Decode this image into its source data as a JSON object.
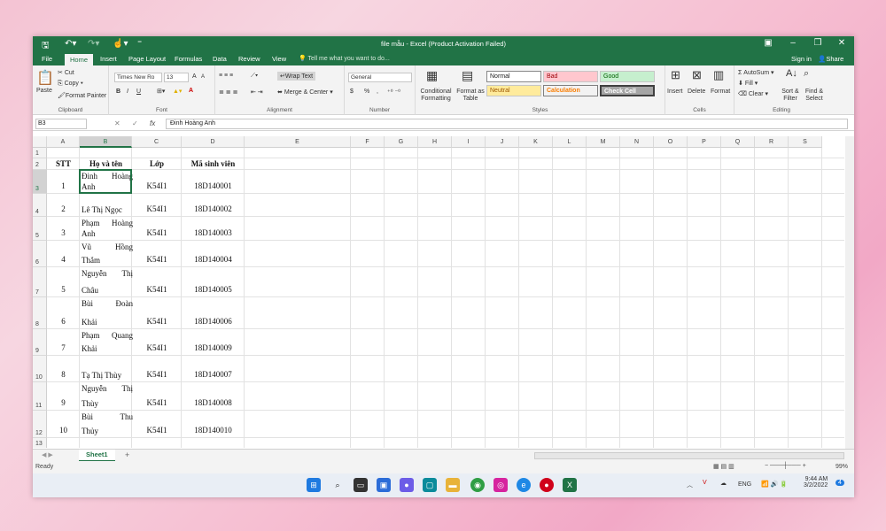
{
  "window": {
    "title": "file mẫu - Excel (Product Activation Failed)"
  },
  "tabs": [
    {
      "label": "File"
    },
    {
      "label": "Home"
    },
    {
      "label": "Insert"
    },
    {
      "label": "Page Layout"
    },
    {
      "label": "Formulas"
    },
    {
      "label": "Data"
    },
    {
      "label": "Review"
    },
    {
      "label": "View"
    }
  ],
  "tell_me": "Tell me what you want to do...",
  "account": {
    "signin": "Sign in",
    "share": "Share"
  },
  "ribbon": {
    "clipboard": {
      "label": "Clipboard",
      "paste": "Paste",
      "cut": "Cut",
      "copy": "Copy",
      "format_painter": "Format Painter"
    },
    "font": {
      "label": "Font",
      "name": "Times New Ro",
      "size": "13",
      "bold": "B",
      "italic": "I",
      "underline": "U",
      "grow": "A",
      "shrink": "A",
      "color_a": "A"
    },
    "alignment": {
      "label": "Alignment",
      "wrap": "Wrap Text",
      "merge": "Merge & Center"
    },
    "number": {
      "label": "Number",
      "format": "General",
      "currency": "$",
      "percent": "%",
      "comma": ","
    },
    "styles": {
      "label": "Styles",
      "conditional": "Conditional Formatting",
      "format_table": "Format as Table",
      "normal": "Normal",
      "bad": "Bad",
      "good": "Good",
      "neutral": "Neutral",
      "calculation": "Calculation",
      "check_cell": "Check Cell"
    },
    "cells": {
      "label": "Cells",
      "insert": "Insert",
      "delete": "Delete",
      "format": "Format"
    },
    "editing": {
      "label": "Editing",
      "autosum": "AutoSum",
      "fill": "Fill",
      "clear": "Clear",
      "sort": "Sort & Filter",
      "find": "Find & Select"
    }
  },
  "formula_bar": {
    "cell_ref": "B3",
    "fx": "fx",
    "value": "Đinh Hoàng Anh"
  },
  "columns": [
    "A",
    "B",
    "C",
    "D",
    "E",
    "F",
    "G",
    "H",
    "I",
    "J",
    "K",
    "L",
    "M",
    "N",
    "O",
    "P",
    "Q",
    "R",
    "S"
  ],
  "rows": [
    "1",
    "2",
    "3",
    "4",
    "5",
    "6",
    "7",
    "8",
    "9",
    "10",
    "11",
    "12",
    "13"
  ],
  "headers": {
    "stt": "STT",
    "name": "Họ và tên",
    "class": "Lớp",
    "id": "Mã sinh viên"
  },
  "students": [
    {
      "stt": "1",
      "name1": "Đinh Hoàng",
      "name2": "Anh",
      "class": "K54I1",
      "id": "18D140001"
    },
    {
      "stt": "2",
      "name1": "",
      "name2": "Lê Thị Ngọc",
      "class": "K54I1",
      "id": "18D140002"
    },
    {
      "stt": "3",
      "name1": "Phạm Hoàng",
      "name2": "Anh",
      "class": "K54I1",
      "id": "18D140003"
    },
    {
      "stt": "4",
      "name1": "Vũ Hồng",
      "name2": "Thắm",
      "class": "K54I1",
      "id": "18D140004"
    },
    {
      "stt": "5",
      "name1": "Nguyễn Thị",
      "name2": "Châu",
      "class": "K54I1",
      "id": "18D140005"
    },
    {
      "stt": "6",
      "name1": "Bùi Đoàn",
      "name2": "Khải",
      "class": "K54I1",
      "id": "18D140006"
    },
    {
      "stt": "7",
      "name1": "Phạm Quang",
      "name2": "Khải",
      "class": "K54I1",
      "id": "18D140009"
    },
    {
      "stt": "8",
      "name1": "",
      "name2": "Tạ Thị Thùy",
      "class": "K54I1",
      "id": "18D140007"
    },
    {
      "stt": "9",
      "name1": "Nguyễn Thị",
      "name2": "Thùy",
      "class": "K54I1",
      "id": "18D140008"
    },
    {
      "stt": "10",
      "name1": "Bùi Thu",
      "name2": "Thủy",
      "class": "K54I1",
      "id": "18D140010"
    }
  ],
  "sheet": {
    "name": "Sheet1",
    "add": "+"
  },
  "status": {
    "ready": "Ready",
    "zoom": "99%"
  },
  "taskbar": {
    "lang": "ENG",
    "time": "9:44 AM",
    "date": "3/2/2022",
    "badge": "4"
  }
}
